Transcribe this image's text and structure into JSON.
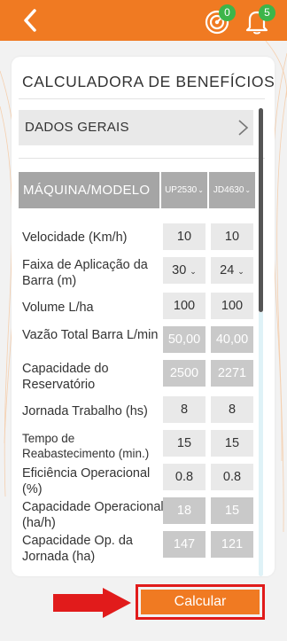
{
  "header": {
    "back_icon": "back-arrow-icon",
    "notification_icons": [
      {
        "icon": "target-icon",
        "badge": "0"
      },
      {
        "icon": "bell-icon",
        "badge": "5"
      }
    ]
  },
  "card": {
    "title": "CALCULADORA DE BENEFÍCIOS",
    "section": {
      "label": "DADOS GERAIS",
      "icon": "chevron-right-icon"
    },
    "table": {
      "header": "MÁQUINA/MODELO",
      "models": [
        "UP2530",
        "JD4630"
      ],
      "rows": [
        {
          "label": "Velocidade (Km/h)",
          "values": [
            "10",
            "10"
          ]
        },
        {
          "label": "Faixa de Aplicação da Barra (m)",
          "values": [
            "30",
            "24"
          ]
        },
        {
          "label": "Volume L/ha",
          "values": [
            "100",
            "100"
          ]
        },
        {
          "label": "Vazão Total Barra L/min",
          "values": [
            "50,00",
            "40,00"
          ]
        },
        {
          "label": "Capacidade do Reservatório",
          "values": [
            "2500",
            "2271"
          ]
        },
        {
          "label": "Jornada Trabalho (hs)",
          "values": [
            "8",
            "8"
          ]
        },
        {
          "label": "Tempo de Reabastecimento (min.)",
          "values": [
            "15",
            "15"
          ]
        },
        {
          "label": "Eficiência Operacional (%)",
          "values": [
            "0.8",
            "0.8"
          ]
        },
        {
          "label": "Capacidade Operacional (ha/h)",
          "values": [
            "18",
            "15"
          ]
        },
        {
          "label": "Capacidade Op. da Jornada (ha)",
          "values": [
            "147",
            "121"
          ]
        }
      ]
    }
  },
  "actions": {
    "calculate_label": "Calcular"
  },
  "colors": {
    "brand_orange": "#f07a22",
    "badge_green": "#3db54a",
    "highlight_red": "#e11b1b"
  }
}
